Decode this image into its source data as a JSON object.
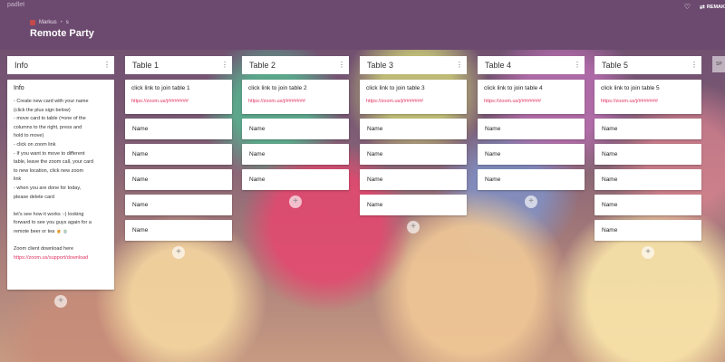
{
  "app": {
    "logo": "padlet"
  },
  "header": {
    "author": "Markus",
    "author_suffix": "s",
    "title": "Remote Party",
    "remake_label": "REMAK",
    "heart_icon": "heart-icon",
    "remake_icon": "remake-icon"
  },
  "info": {
    "column_title": "Info",
    "card_heading": "Info",
    "body": "- Create new card with your name\n(click the plus sign below)\n- move card to table (=one of the\ncolumns to the right, press and\nhold to move)\n- click on zoom link\n- If you want to move to different\ntable, leave the zoom call, your card\nto new location, click new zoom\nlink\n- when you are done for today,\nplease delete card\n\nlet's see how it works :-) looking\nforward to see you guys again for a\nremote beer or tea 🍺🍵\n\nZoom client download here",
    "link": "https://zoom.us/support/download"
  },
  "tables": [
    {
      "title": "Table 1",
      "link_text": "click link to join table 1",
      "url": "https://zoom.us/j/#######",
      "names": [
        "Name",
        "Name",
        "Name",
        "Name",
        "Name"
      ]
    },
    {
      "title": "Table 2",
      "link_text": "click link to join table 2",
      "url": "https://zoom.us/j/#######",
      "names": [
        "Name",
        "Name",
        "Name"
      ]
    },
    {
      "title": "Table 3",
      "link_text": "click link to join table 3",
      "url": "https://zoom.us/j/#######",
      "names": [
        "Name",
        "Name",
        "Name",
        "Name"
      ]
    },
    {
      "title": "Table 4",
      "link_text": "click link to join table 4",
      "url": "https://zoom.us/j/#######",
      "names": [
        "Name",
        "Name",
        "Name"
      ]
    },
    {
      "title": "Table 5",
      "link_text": "click link to join table 5",
      "url": "https://zoom.us/j/#######",
      "names": [
        "Name",
        "Name",
        "Name",
        "Name",
        "Name"
      ]
    }
  ],
  "partial_column_label": "SP",
  "add_symbol": "+",
  "kebab_symbol": "⋮"
}
